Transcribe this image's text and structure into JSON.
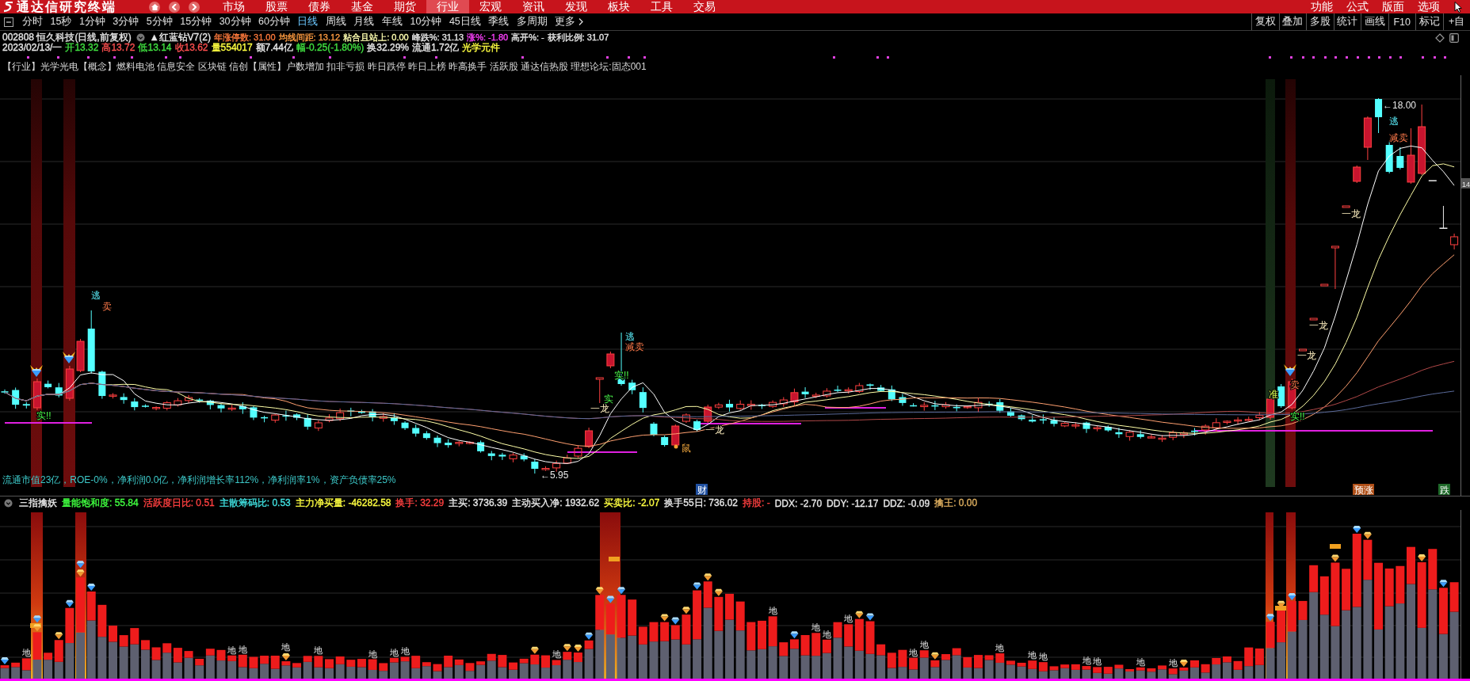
{
  "menu_bar": {
    "app_title": "通达信研究终端",
    "items": [
      {
        "label": "市场",
        "selected": false
      },
      {
        "label": "股票",
        "selected": false
      },
      {
        "label": "债券",
        "selected": false
      },
      {
        "label": "基金",
        "selected": false
      },
      {
        "label": "期货",
        "selected": false
      },
      {
        "label": "行业",
        "selected": true
      },
      {
        "label": "宏观",
        "selected": false
      },
      {
        "label": "资讯",
        "selected": false
      },
      {
        "label": "发现",
        "selected": false
      },
      {
        "label": "板块",
        "selected": false
      },
      {
        "label": "工具",
        "selected": false
      },
      {
        "label": "交易",
        "selected": false
      }
    ],
    "right_items": [
      "功能",
      "公式",
      "版面",
      "选项"
    ]
  },
  "period_bar": {
    "periods": [
      {
        "label": "分时",
        "selected": false
      },
      {
        "label": "15秒",
        "selected": false
      },
      {
        "label": "1分钟",
        "selected": false
      },
      {
        "label": "3分钟",
        "selected": false
      },
      {
        "label": "5分钟",
        "selected": false
      },
      {
        "label": "15分钟",
        "selected": false
      },
      {
        "label": "30分钟",
        "selected": false
      },
      {
        "label": "60分钟",
        "selected": false
      },
      {
        "label": "日线",
        "selected": true
      },
      {
        "label": "周线",
        "selected": false
      },
      {
        "label": "月线",
        "selected": false
      },
      {
        "label": "年线",
        "selected": false
      },
      {
        "label": "10分钟",
        "selected": false
      },
      {
        "label": "45日线",
        "selected": false
      },
      {
        "label": "季线",
        "selected": false
      },
      {
        "label": "多周期",
        "selected": false
      }
    ],
    "more": "更多",
    "tools": [
      "复权",
      "叠加",
      "多股",
      "统计",
      "画线",
      "F10",
      "标记",
      "+自"
    ]
  },
  "chart_header": {
    "title": "002808 恒久科技(日线,前复权)",
    "indicator": "▲红蓝钻V7(2)",
    "values": [
      {
        "text": "年涨停数: 31.00",
        "color": "#ff7a3c"
      },
      {
        "text": "均线间距: 13.12",
        "color": "#ff9c40"
      },
      {
        "text": "粘合且站上: 0.00",
        "color": "#ffffb0"
      },
      {
        "text": "峰跌%: 31.13",
        "color": "#e8e8e8"
      },
      {
        "text": "涨%: -1.80",
        "color": "#ff40ff"
      },
      {
        "text": "高开%: -",
        "color": "#e8e8e8"
      },
      {
        "text": "获利比例: 31.07",
        "color": "#e8e8e8"
      }
    ]
  },
  "quote_line": [
    {
      "text": "2023/02/13/一",
      "color": "#e8e8e8"
    },
    {
      "text": "开13.32",
      "color": "#40e040"
    },
    {
      "text": "高13.72",
      "color": "#ff5050"
    },
    {
      "text": "低13.14",
      "color": "#40e040"
    },
    {
      "text": "收13.62",
      "color": "#ff5050"
    },
    {
      "text": "量554017",
      "color": "#ffff40"
    },
    {
      "text": "额7.44亿",
      "color": "#e8e8e8"
    },
    {
      "text": "幅-0.25(-1.80%)",
      "color": "#40e040"
    },
    {
      "text": "换32.29%",
      "color": "#e8e8e8"
    },
    {
      "text": "流通1.72亿",
      "color": "#e8e8e8"
    },
    {
      "text": "光学元件",
      "color": "#ffff40"
    }
  ],
  "tags_line": "【行业】光学光电【概念】燃料电池 信息安全 区块链 信创【属性】户数增加 扣非亏损 昨日跌停 昨日上榜 昨高换手 活跃股 通达信热股 理想论坛:固态001",
  "main_chart": {
    "price_tag": "14",
    "labels": [
      {
        "kind": "escape",
        "text": "逃"
      },
      {
        "kind": "sell",
        "text": "卖"
      },
      {
        "kind": "breakout",
        "text": "实!!"
      },
      {
        "kind": "escape",
        "text": "逃"
      },
      {
        "kind": "sell",
        "text": "减卖"
      },
      {
        "kind": "breakout",
        "text": "实!!"
      },
      {
        "kind": "breakout",
        "text": "实"
      },
      {
        "kind": "dragon",
        "text": "一龙"
      },
      {
        "kind": "dragon",
        "text": "一龙"
      },
      {
        "kind": "rat",
        "text": "鼠"
      },
      {
        "kind": "price",
        "text": "←5.95"
      },
      {
        "kind": "price",
        "text": "←18.00"
      },
      {
        "kind": "escape",
        "text": "逃"
      },
      {
        "kind": "sell",
        "text": "减卖"
      },
      {
        "kind": "dragon",
        "text": "一龙"
      },
      {
        "kind": "dragon",
        "text": "一龙"
      },
      {
        "kind": "dragon",
        "text": "一龙"
      },
      {
        "kind": "ready",
        "text": "准"
      },
      {
        "kind": "sell",
        "text": "卖"
      },
      {
        "kind": "breakout",
        "text": "实!!"
      }
    ],
    "fundamentals": "流通市值23亿，ROE-0%，净利润0.0亿，净利润增长率112%，净利润率1%，资产负债率25%",
    "badges": [
      {
        "text": "财",
        "color": "#2050a0"
      },
      {
        "text": "预涨",
        "color": "#b05018"
      },
      {
        "text": "跌",
        "color": "#1f6a2a"
      }
    ]
  },
  "indicator": {
    "name": "三指擒妖",
    "values": [
      {
        "text": "量能饱和度: 55.84",
        "color": "#40ff40"
      },
      {
        "text": "活跃度日比: 0.51",
        "color": "#ff4040"
      },
      {
        "text": "主散筹码比: 0.53",
        "color": "#40e0e0"
      },
      {
        "text": "主力净买量: -46282.58",
        "color": "#ffff40"
      },
      {
        "text": "换手: 32.29",
        "color": "#ff4040"
      },
      {
        "text": "主买: 3736.39",
        "color": "#e8e8e8"
      },
      {
        "text": "主动买入净: 1932.62",
        "color": "#e8e8e8"
      },
      {
        "text": "买卖比: -2.07",
        "color": "#ffff40"
      },
      {
        "text": "换手55日: 736.02",
        "color": "#e8e8e8"
      },
      {
        "text": "持股: -",
        "color": "#ff4040"
      },
      {
        "text": "DDX: -2.70",
        "color": "#e8e8e8"
      },
      {
        "text": "DDY: -12.17",
        "color": "#e8e8e8"
      },
      {
        "text": "DDZ: -0.09",
        "color": "#e8e8e8"
      },
      {
        "text": "擒王: 0.00",
        "color": "#e0b060"
      }
    ],
    "bottom_labels": [
      "地",
      "地",
      "地",
      "地",
      "地",
      "地",
      "地",
      "地",
      "地",
      "地",
      "地",
      "地",
      "地",
      "地",
      "地",
      "地",
      "地",
      "地",
      "地",
      "地",
      "地",
      "地"
    ]
  }
}
